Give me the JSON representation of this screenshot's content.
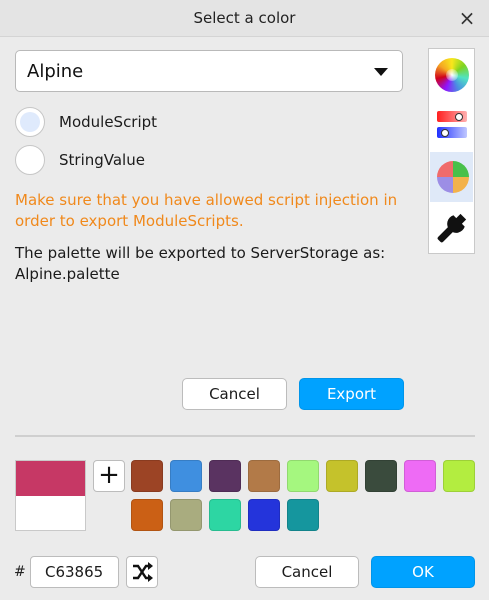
{
  "dialog": {
    "title": "Select a color",
    "close_glyph": "×"
  },
  "palette_select": {
    "selected": "Alpine"
  },
  "export_options": {
    "items": [
      {
        "label": "ModuleScript",
        "selected": true
      },
      {
        "label": "StringValue",
        "selected": false
      }
    ]
  },
  "warning_text": "Make sure that you have allowed script injection in order to export ModuleScripts.",
  "info_text": "The palette will be exported to ServerStorage as: Alpine.palette",
  "export_panel": {
    "cancel_label": "Cancel",
    "export_label": "Export"
  },
  "sidebar": {
    "tabs": [
      {
        "icon": "color-wheel-icon",
        "active": false
      },
      {
        "icon": "color-sliders-icon",
        "active": false
      },
      {
        "icon": "palette-pie-icon",
        "active": true
      },
      {
        "icon": "wrench-icon",
        "active": false
      }
    ]
  },
  "preview": {
    "current_color": "#C63865",
    "previous_color": "#FFFFFF"
  },
  "palette": {
    "add_glyph": "+",
    "swatches": [
      "#9C4425",
      "#3F8FE0",
      "#5A3361",
      "#B27A48",
      "#A5F77F",
      "#C5C22B",
      "#3A4B3D",
      "#EE6BF5",
      "#B3ED40",
      "#CB6015",
      "#A9AC7F",
      "#2DD6A3",
      "#2434DB",
      "#15969E"
    ]
  },
  "color_input": {
    "hash": "#",
    "value": "C63865"
  },
  "footer": {
    "cancel_label": "Cancel",
    "ok_label": "OK"
  },
  "colors": {
    "accent": "#00A2FF",
    "warning": "#F0891C"
  }
}
